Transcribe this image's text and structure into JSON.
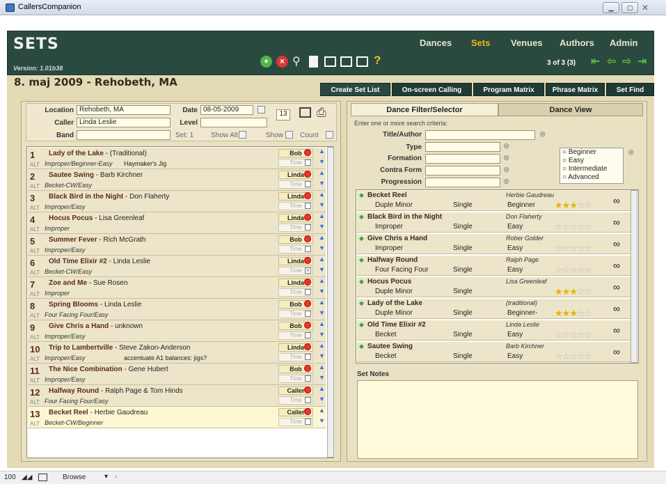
{
  "window": {
    "title": "CallersCompanion"
  },
  "header": {
    "section_title": "Sets",
    "version": "Version: 1.01b38",
    "nav": [
      "Dances",
      "Sets",
      "Venues",
      "Authors",
      "Admin"
    ],
    "active_nav": "Sets",
    "record_counter": "3 of 3 (3)",
    "help": "?"
  },
  "record": {
    "title": "8. maj 2009 - Rehobeth, MA"
  },
  "tabs": [
    "Create Set List",
    "On-screen Calling",
    "Program Matrix",
    "Phrase Matrix",
    "Set Find"
  ],
  "info": {
    "location_label": "Location",
    "location": "Rehobeth, MA",
    "date_label": "Date",
    "date": "08-05-2009",
    "count_box": "13",
    "caller_label": "Caller",
    "caller": "Linda Leslie",
    "level_label": "Level",
    "level": "",
    "band_label": "Band",
    "band": "",
    "set_label": "Set: 1",
    "show_alt_label": "Show Alt",
    "show_label": "Show",
    "count_label": "Count"
  },
  "setlist": [
    {
      "num": "1",
      "title": "Lady of the Lake",
      "author": "(Traditional)",
      "sub": "Improper/Beginner-Easy",
      "note": "Haymaker's Jig",
      "caller": "Bob",
      "time": "Time",
      "checked": false
    },
    {
      "num": "2",
      "title": "Sautee Swing",
      "author": "Barb Kirchner",
      "sub": "Becket-CW/Easy",
      "note": "",
      "caller": "Linda",
      "time": "Time",
      "checked": false
    },
    {
      "num": "3",
      "title": "Black Bird in the Night",
      "author": "Don Flaherty",
      "sub": "Improper/Easy",
      "note": "",
      "caller": "Linda",
      "time": "Time",
      "checked": false
    },
    {
      "num": "4",
      "title": "Hocus Pocus",
      "author": "Lisa Greenleaf",
      "sub": "Improper",
      "note": "",
      "caller": "Linda",
      "time": "Time",
      "checked": false
    },
    {
      "num": "5",
      "title": "Summer Fever",
      "author": "Rich McGrath",
      "sub": "Improper/Easy",
      "note": "",
      "caller": "Bob",
      "time": "Time",
      "checked": false
    },
    {
      "num": "6",
      "title": "Old Time Elixir #2",
      "author": "Linda Leslie",
      "sub": "Becket-CW/Easy",
      "note": "",
      "caller": "Linda",
      "time": "Time",
      "checked": true
    },
    {
      "num": "7",
      "title": "Zoe and Me",
      "author": "Sue Rosen",
      "sub": "Improper",
      "note": "",
      "caller": "Linda",
      "time": "Time",
      "checked": false
    },
    {
      "num": "8",
      "title": "Spring Blooms",
      "author": "Linda Leslie",
      "sub": "Four Facing Four/Easy",
      "note": "",
      "caller": "Bob",
      "time": "Time",
      "checked": false
    },
    {
      "num": "9",
      "title": "Give Chris a Hand",
      "author": "unknown",
      "sub": "Improper/Easy",
      "note": "",
      "caller": "Bob",
      "time": "Time",
      "checked": false
    },
    {
      "num": "10",
      "title": "Trip to Lambertville",
      "author": "Steve Zakon-Anderson",
      "sub": "Improper/Easy",
      "note": "accentuate A1 balances: jigs?",
      "caller": "Linda",
      "time": "Time",
      "checked": false
    },
    {
      "num": "11",
      "title": "The Nice Combination",
      "author": "Gene Hubert",
      "sub": "Improper/Easy",
      "note": "",
      "caller": "Bob",
      "time": "Time",
      "checked": false
    },
    {
      "num": "12",
      "title": "Halfway Round",
      "author": "Ralph Page & Tom Hinds",
      "sub": "Four Facing Four/Easy",
      "note": "",
      "caller": "Caller",
      "time": "Time",
      "checked": false
    },
    {
      "num": "13",
      "title": "Becket Reel",
      "author": "Herbie Gaudreau",
      "sub": "Becket-CW/Beginner",
      "note": "",
      "caller": "Caller",
      "time": "Time",
      "checked": false
    }
  ],
  "alt_label": "ALT",
  "filter": {
    "tab_filter": "Dance Filter/Selector",
    "tab_view": "Dance View",
    "prompt": "Enter one or more search criteria:",
    "title_author_label": "Title/Author",
    "type_label": "Type",
    "formation_label": "Formation",
    "contra_form_label": "Contra Form",
    "progression_label": "Progression",
    "levels": [
      "Beginner",
      "Easy",
      "Intermediate",
      "Advanced"
    ]
  },
  "dances": [
    {
      "name": "Becket Reel",
      "author": "Herbie Gaudreau",
      "formation": "Duple Minor",
      "prog": "Single",
      "level": "Beginner",
      "stars": 3
    },
    {
      "name": "Black Bird in the Night",
      "author": "Don Flaherty",
      "formation": "Improper",
      "prog": "Single",
      "level": "Easy",
      "stars": 0
    },
    {
      "name": "Give Chris a Hand",
      "author": "Rober Golder",
      "formation": "Improper",
      "prog": "Single",
      "level": "Easy",
      "stars": 0
    },
    {
      "name": "Halfway Round",
      "author": "Ralph Page",
      "formation": "Four Facing Four",
      "prog": "Single",
      "level": "Easy",
      "stars": 0
    },
    {
      "name": "Hocus Pocus",
      "author": "Lisa Greenleaf",
      "formation": "Duple Minor",
      "prog": "Single",
      "level": "",
      "stars": 3
    },
    {
      "name": "Lady of the Lake",
      "author": "(traditional)",
      "formation": "Duple Minor",
      "prog": "Single",
      "level": "Beginner-",
      "stars": 3
    },
    {
      "name": "Old Time Elixir #2",
      "author": "Linda Leslie",
      "formation": "Becket",
      "prog": "Single",
      "level": "Easy",
      "stars": 0
    },
    {
      "name": "Sautee Swing",
      "author": "Barb Kirchner",
      "formation": "Becket",
      "prog": "Single",
      "level": "Easy",
      "stars": 0
    }
  ],
  "notes": {
    "label": "Set Notes",
    "text": ""
  },
  "status": {
    "zoom": "100",
    "mode": "Browse"
  }
}
